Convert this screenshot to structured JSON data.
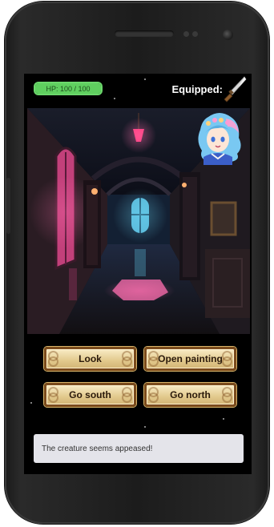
{
  "hud": {
    "hp_text": "HP: 100 / 100",
    "hp_current": 100,
    "hp_max": 100,
    "equipped_label": "Equipped:",
    "equipped_item_icon": "knife-icon"
  },
  "scene": {
    "location_image": "haunted-hallway",
    "companion_avatar": "blue-haired-girl-avatar"
  },
  "actions": [
    {
      "label": "Look"
    },
    {
      "label": "Open painting"
    },
    {
      "label": "Go south"
    },
    {
      "label": "Go north"
    }
  ],
  "message": {
    "text": "The creature seems appeased!"
  },
  "colors": {
    "hp_green": "#5fcf5f",
    "button_gold": "#e2c98c",
    "button_border": "#7a4a1c",
    "message_bg": "#e4e4ea"
  }
}
